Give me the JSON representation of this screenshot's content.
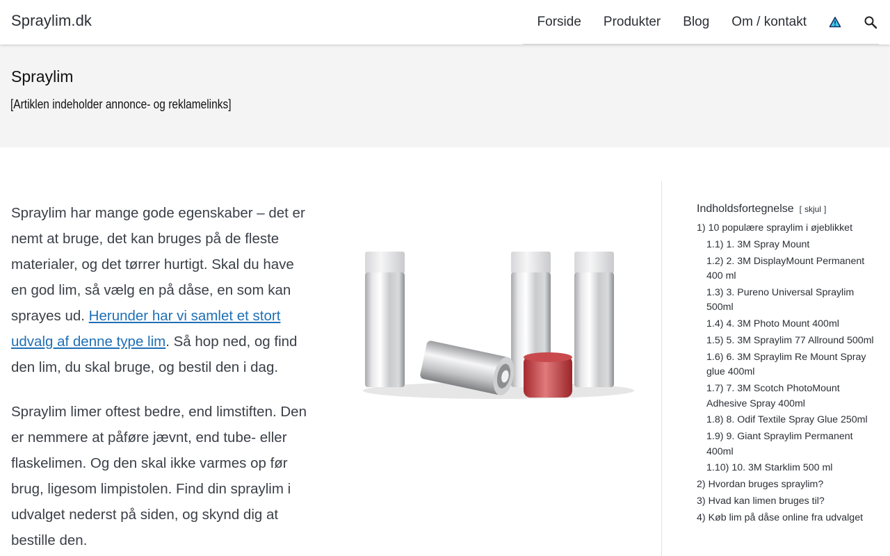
{
  "site": {
    "logo": "Spraylim.dk"
  },
  "nav": {
    "items": [
      "Forside",
      "Produkter",
      "Blog",
      "Om / kontakt"
    ],
    "warning_icon": "warning-triangle-icon",
    "search_icon": "search-icon"
  },
  "hero": {
    "title": "Spraylim",
    "disclaimer": "[Artiklen indeholder annonce- og reklamelinks]"
  },
  "content": {
    "intro_before_link": "Spraylim har mange gode egenskaber – det er nemt at bruge, det kan bruges på de fleste materialer, og det tørrer hurtigt. Skal du have en god lim, så vælg en på dåse, en som kan sprayes ud. ",
    "intro_link": "Herunder har vi samlet et stort udvalg af denne type lim",
    "intro_after_link": ". Så hop ned, og find den lim, du skal bruge, og bestil den i dag.",
    "second_paragraph": "Spraylim limer oftest bedre, end limstiften. Den er nemmere at påføre jævnt, end tube- eller flaskelimen. Og den skal ikke varmes op før brug, ligesom limpistolen. Find din spraylim i udvalget nederst på siden, og skynd dig at bestille den."
  },
  "toc": {
    "title": "Indholdsfortegnelse",
    "toggle_open": "[",
    "toggle_label": "skjul",
    "toggle_close": "]",
    "items": [
      {
        "num": "1)",
        "label": "10 populære spraylim i øjeblikket",
        "sub": false
      },
      {
        "num": "1.1)",
        "label": "1. 3M Spray Mount",
        "sub": true
      },
      {
        "num": "1.2)",
        "label": "2. 3M DisplayMount Permanent 400 ml",
        "sub": true
      },
      {
        "num": "1.3)",
        "label": "3. Pureno Universal Spraylim 500ml",
        "sub": true
      },
      {
        "num": "1.4)",
        "label": "4. 3M Photo Mount 400ml",
        "sub": true
      },
      {
        "num": "1.5)",
        "label": "5. 3M Spraylim 77 Allround 500ml",
        "sub": true
      },
      {
        "num": "1.6)",
        "label": "6. 3M Spraylim Re Mount Spray glue 400ml",
        "sub": true
      },
      {
        "num": "1.7)",
        "label": "7. 3M Scotch PhotoMount Adhesive Spray 400ml",
        "sub": true
      },
      {
        "num": "1.8)",
        "label": "8. Odif Textile Spray Glue 250ml",
        "sub": true
      },
      {
        "num": "1.9)",
        "label": "9. Giant Spraylim Permanent 400ml",
        "sub": true
      },
      {
        "num": "1.10)",
        "label": "10. 3M Starklim 500 ml",
        "sub": true
      },
      {
        "num": "2)",
        "label": "Hvordan bruges spraylim?",
        "sub": false
      },
      {
        "num": "3)",
        "label": "Hvad kan limen bruges til?",
        "sub": false
      },
      {
        "num": "4)",
        "label": "Køb lim på dåse online fra udvalget",
        "sub": false
      }
    ]
  },
  "colors": {
    "link": "#1e6fb5",
    "title_band": "#f4f4f4",
    "text": "#3a3f47"
  }
}
